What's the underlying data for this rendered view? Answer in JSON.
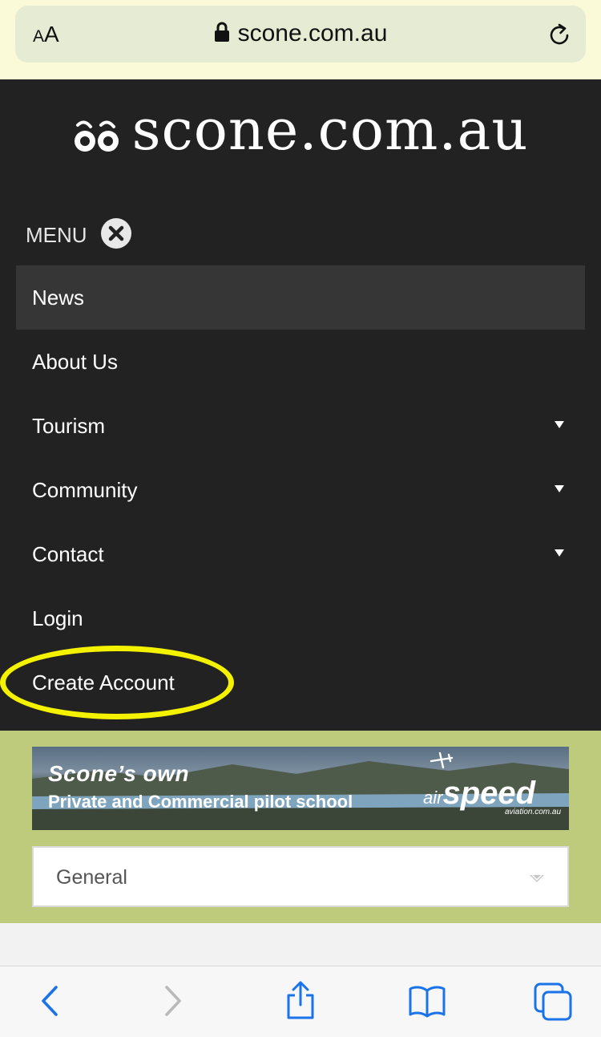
{
  "browser": {
    "text_size_label_small": "A",
    "text_size_label_large": "A",
    "url": "scone.com.au"
  },
  "site": {
    "logo_text": "scone.com.au",
    "menu_label": "MENU",
    "nav": [
      {
        "label": "News",
        "active": true,
        "has_submenu": false
      },
      {
        "label": "About Us",
        "active": false,
        "has_submenu": false
      },
      {
        "label": "Tourism",
        "active": false,
        "has_submenu": true
      },
      {
        "label": "Community",
        "active": false,
        "has_submenu": true
      },
      {
        "label": "Contact",
        "active": false,
        "has_submenu": true
      },
      {
        "label": "Login",
        "active": false,
        "has_submenu": false
      },
      {
        "label": "Create Account",
        "active": false,
        "has_submenu": false,
        "highlighted": true
      }
    ]
  },
  "banner": {
    "title": "Scone’s own",
    "subtitle": "Private and Commercial pilot school",
    "brand_air": "air",
    "brand_speed": "speed",
    "brand_url": "aviation.com.au"
  },
  "category_select": {
    "value": "General"
  },
  "colors": {
    "site_bg": "#222222",
    "active_item_bg": "#363636",
    "band_bg": "#bfcb7c",
    "highlight": "#f5f200",
    "toolbar_icon": "#1a73e8"
  }
}
